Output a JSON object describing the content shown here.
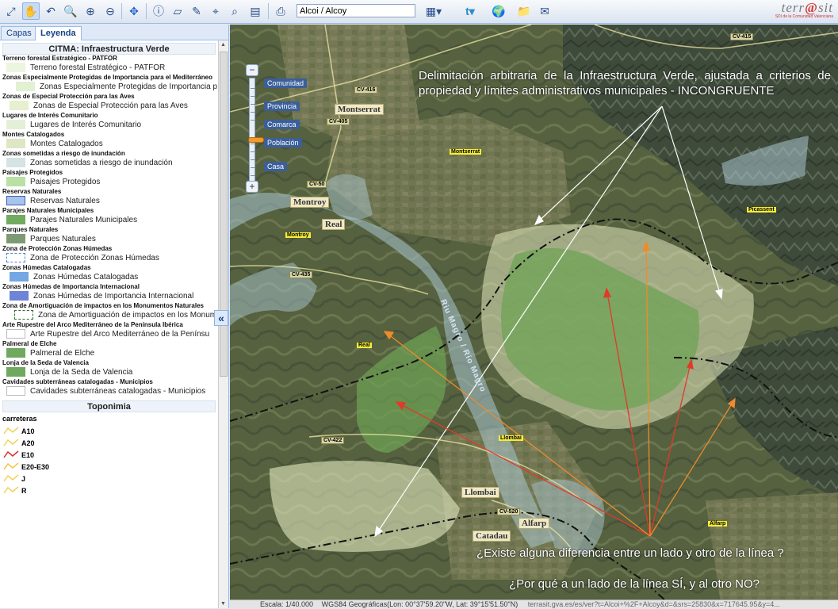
{
  "toolbar": {
    "search_value": "Alcoi / Alcoy",
    "logo_text": "terrasit",
    "logo_sub": "SDI de la Comunidad Valenciana"
  },
  "tabs": [
    {
      "label": "Capas"
    },
    {
      "label": "Leyenda"
    }
  ],
  "legend": {
    "title": "CITMA: Infraestructura Verde",
    "groups": [
      {
        "title": "Terreno forestal Estratégico - PATFOR",
        "label": "Terreno forestal Estratégico - PATFOR",
        "fill": "#ecf5df",
        "border": "#ecf5df"
      },
      {
        "title": "Zonas Especialmente Protegidas de Importancia para el Mediterráneo",
        "label": "Zonas Especialmente Protegidas de Importancia p",
        "fill": "#e2f0d3",
        "border": "#e2f0d3"
      },
      {
        "title": "Zonas de Especial Protección para las Aves",
        "label": "Zonas de Especial Protección para las Aves",
        "fill": "#e6efcf",
        "border": "#e6efcf"
      },
      {
        "title": "Lugares de Interés Comunitario",
        "label": "Lugares de Interés Comunitario",
        "fill": "#e4efd8",
        "border": "#e4efd8"
      },
      {
        "title": "Montes Catalogados",
        "label": "Montes Catalogados",
        "fill": "#dfe6c4",
        "border": "#dfe6c4"
      },
      {
        "title": "Zonas sometidas a riesgo de inundación",
        "label": "Zonas sometidas a riesgo de inundación",
        "fill": "#d5e3e2",
        "border": "#d5e3e2"
      },
      {
        "title": "Paisajes Protegidos",
        "label": "Paisajes Protegidos",
        "fill": "#b8e1a3",
        "border": "#b8e1a3"
      },
      {
        "title": "Reservas Naturales",
        "label": "Reservas Naturales",
        "fill": "#a8c4ec",
        "border": "#3a5fb0"
      },
      {
        "title": "Parajes Naturales Municipales",
        "label": "Parajes Naturales Municipales",
        "fill": "#71ab5d",
        "border": "#71ab5d"
      },
      {
        "title": "Parques Naturales",
        "label": "Parques Naturales",
        "fill": "#7e9a74",
        "border": "#7e9a74"
      },
      {
        "title": "Zona de Protección Zonas Húmedas",
        "label": "Zona de Protección Zonas Húmedas",
        "fill": "#ffffff",
        "border": "#4b86d8",
        "dashed": true
      },
      {
        "title": "Zonas Húmedas Catalogadas",
        "label": "Zonas Húmedas Catalogadas",
        "fill": "#74a7e3",
        "border": "#74a7e3"
      },
      {
        "title": "Zonas Húmedas de Importancia Internacional",
        "label": "Zonas Húmedas de Importancia Internacional",
        "fill": "#6e84d6",
        "border": "#6e84d6"
      },
      {
        "title": "Zona de Amortiguación de impactos en los Monumentos Naturales",
        "label": "Zona de Amortiguación de impactos en los Monum",
        "fill": "#ffffff",
        "border": "#2e6b2e",
        "dashed": true
      },
      {
        "title": "Arte Rupestre del Arco Mediterráneo de la Península Ibérica",
        "label": "Arte Rupestre del Arco Mediterráneo de la Penínsu",
        "fill": "#ffffff",
        "border": "#bbbbbb"
      },
      {
        "title": "Palmeral de Elche",
        "label": "Palmeral de Elche",
        "fill": "#6fa85e",
        "border": "#6fa85e"
      },
      {
        "title": "Lonja de la Seda de Valencia",
        "label": "Lonja de la Seda de Valencia",
        "fill": "#6fa85e",
        "border": "#6fa85e"
      },
      {
        "title": "Cavidades subterráneas catalogadas - Municipios",
        "label": "Cavidades subterráneas catalogadas - Municipios",
        "fill": "#ffffff",
        "border": "#bbbbbb"
      }
    ],
    "toponimia_title": "Toponimia",
    "carreteras_title": "carreteras",
    "roads": [
      {
        "label": "A10",
        "color": "#f1d25a"
      },
      {
        "label": "A20",
        "color": "#f1d25a"
      },
      {
        "label": "E10",
        "color": "#d83030"
      },
      {
        "label": "E20-E30",
        "color": "#f1c84a"
      },
      {
        "label": "J",
        "color": "#f1d25a"
      },
      {
        "label": "R",
        "color": "#f1d25a"
      }
    ]
  },
  "map": {
    "zoom_labels": [
      "Comunidad",
      "Provincia",
      "Comarca",
      "Población",
      "Casa"
    ],
    "places": [
      "Montserrat",
      "Montroy",
      "Real",
      "Llombai",
      "Alfarp",
      "Catadau"
    ],
    "tags": [
      "Montserrat",
      "Montroy",
      "Real",
      "Llombai",
      "Alfarp",
      "Picassent"
    ],
    "roads": [
      "CV-415",
      "CV-416",
      "CV-405",
      "CV-50",
      "CV-435",
      "CV-422",
      "CV-520"
    ],
    "river": "Riu Magro / Río Magro",
    "note": "Delimitación arbitraria de la Infraestructura Verde, ajustada a criterios de propiedad y límites administrativos municipales - INCONGRUENTE",
    "question1": "¿Existe alguna diferencia entre un lado y otro de la línea ?",
    "question2": "¿Por qué a un lado de la línea SÍ, y al otro NO?"
  },
  "status": {
    "scale": "Escala: 1/40.000",
    "coords": "WGS84 Geográficas(Lon: 00°37'59.20\"W, Lat: 39°15'51.50\"N)",
    "url": "terrasit.gva.es/es/ver?t=Alcoi+%2F+Alcoy&d=&srs=25830&x=717645.95&y=4..."
  }
}
